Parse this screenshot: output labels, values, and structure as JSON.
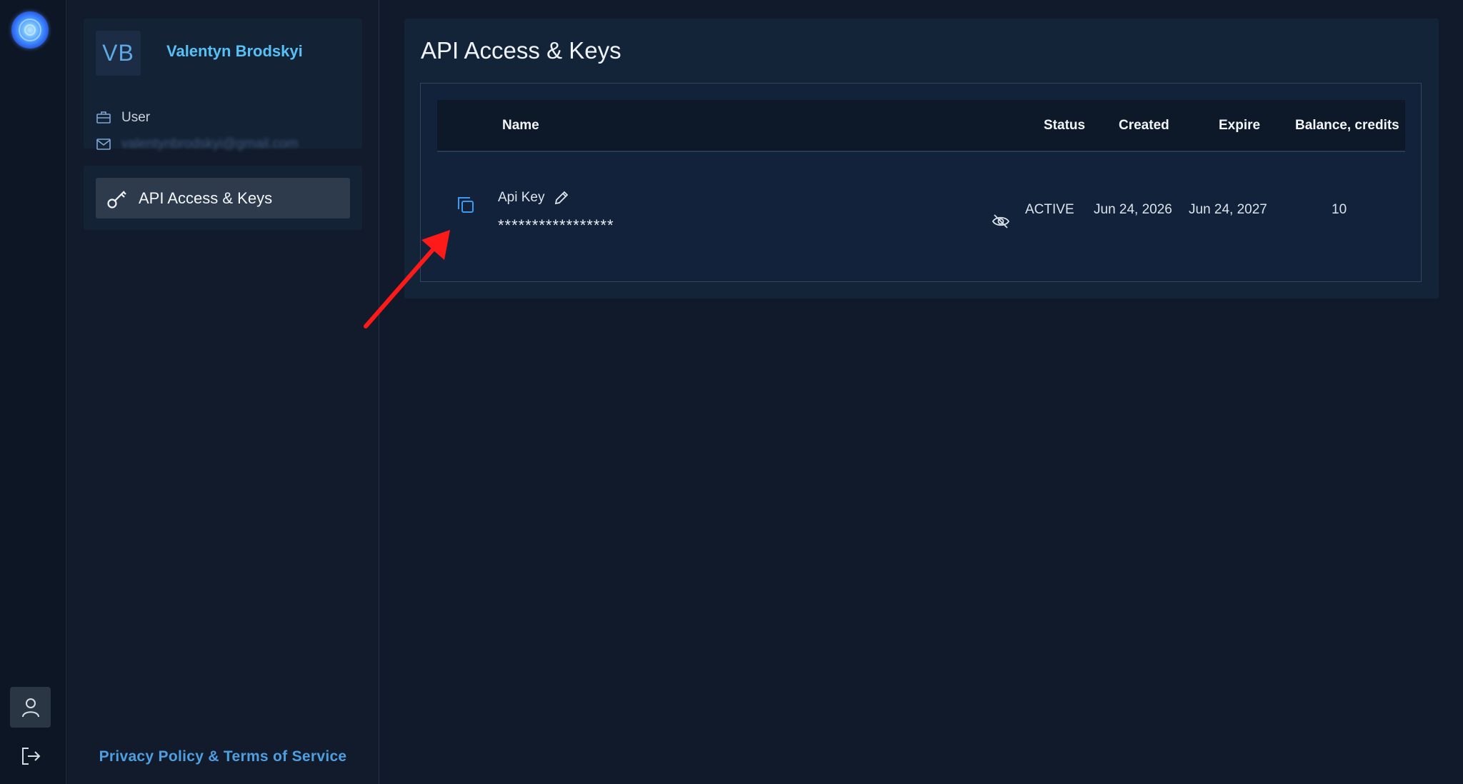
{
  "user": {
    "initials": "VB",
    "name": "Valentyn Brodskyi",
    "role": "User",
    "email": "valentynbrodskyi@gmail.com"
  },
  "sidebar": {
    "nav_items": [
      {
        "label": "API Access & Keys",
        "icon": "key-icon",
        "active": true
      }
    ],
    "footer_link": "Privacy Policy & Terms of Service"
  },
  "rail": {
    "logo": "app-logo",
    "buttons": [
      {
        "icon": "user-profile-icon",
        "active": true
      },
      {
        "icon": "logout-icon",
        "active": false
      }
    ]
  },
  "main": {
    "title": "API Access & Keys",
    "table": {
      "headers": {
        "name": "Name",
        "status": "Status",
        "created": "Created",
        "expire": "Expire",
        "balance": "Balance, credits"
      },
      "rows": [
        {
          "name": "Api Key",
          "secret": "*****************",
          "status": "ACTIVE",
          "created": "Jun 24, 2026",
          "expire": "Jun 24, 2027",
          "balance": "10"
        }
      ]
    }
  },
  "colors": {
    "accent": "#57c1f5",
    "link": "#4f9ee0",
    "copy_icon": "#3d9bef",
    "annotation_arrow": "#ff1a1a"
  }
}
